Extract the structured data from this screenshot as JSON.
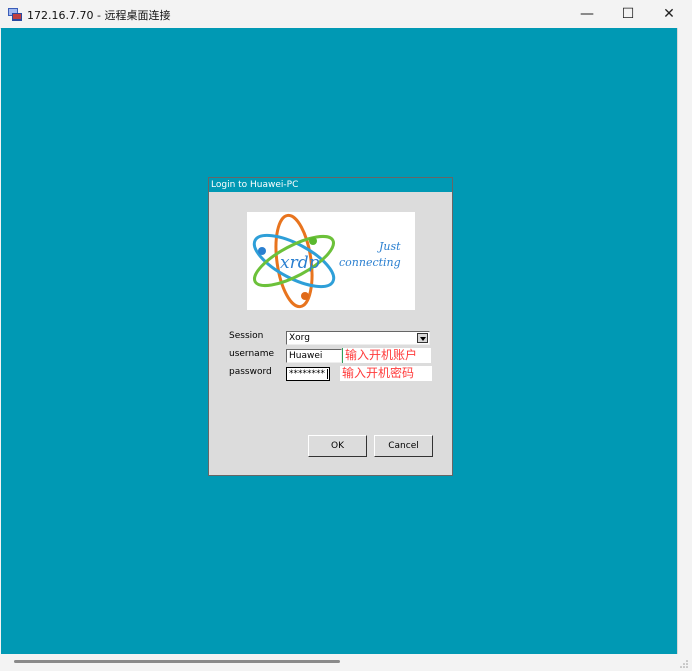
{
  "window": {
    "title": "172.16.7.70 - 远程桌面连接",
    "minimize_glyph": "—",
    "maximize_glyph": "☐",
    "close_glyph": "✕",
    "icon": "remote-desktop-icon"
  },
  "dialog": {
    "title": "Login to Huawei-PC",
    "logo": {
      "brand": "xrdp",
      "tagline_1": "Just",
      "tagline_2": "connecting"
    },
    "session_label": "Session",
    "session_value": "Xorg",
    "username_label": "username",
    "username_value": "Huawei",
    "password_label": "password",
    "password_value": "********",
    "ok_label": "OK",
    "cancel_label": "Cancel"
  },
  "annotations": {
    "username_hint": "输入开机账户",
    "password_hint": "输入开机密码",
    "hint_color": "#ff3b3b"
  },
  "colors": {
    "desktop_bg": "#0099b4",
    "dialog_bg": "#dcdcdc"
  }
}
